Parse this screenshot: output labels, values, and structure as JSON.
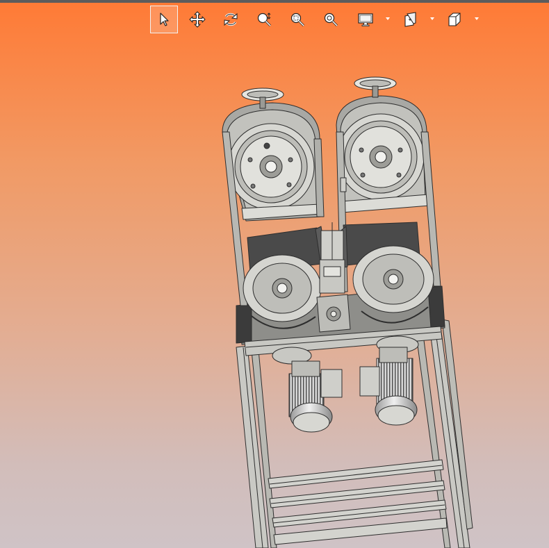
{
  "toolbar": {
    "buttons": [
      {
        "id": "select",
        "icon": "select-arrow-icon",
        "active": true,
        "dropdown": false
      },
      {
        "id": "pan",
        "icon": "pan-move-icon",
        "active": false,
        "dropdown": false
      },
      {
        "id": "rotate",
        "icon": "rotate-icon",
        "active": false,
        "dropdown": false
      },
      {
        "id": "zoom",
        "icon": "zoom-icon",
        "active": false,
        "dropdown": false
      },
      {
        "id": "zoom-window",
        "icon": "zoom-window-icon",
        "active": false,
        "dropdown": false
      },
      {
        "id": "zoom-fit",
        "icon": "zoom-fit-icon",
        "active": false,
        "dropdown": false
      },
      {
        "id": "display-mode",
        "icon": "monitor-icon",
        "active": false,
        "dropdown": true
      },
      {
        "id": "section-view",
        "icon": "section-view-icon",
        "active": false,
        "dropdown": true
      },
      {
        "id": "view-orientation",
        "icon": "cube-view-icon",
        "active": false,
        "dropdown": true
      }
    ]
  },
  "viewport": {
    "background_top": "#ff7a35",
    "background_bottom": "#cfc3c6",
    "model": "band-saw-machine-3d-model"
  }
}
